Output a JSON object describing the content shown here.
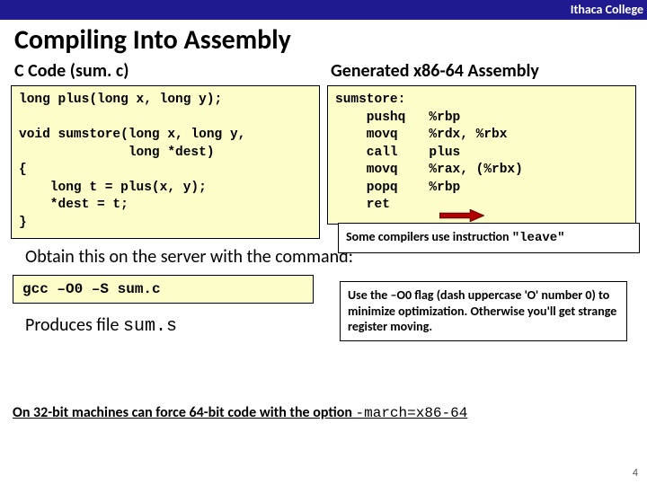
{
  "header": {
    "org": "Ithaca College"
  },
  "title": "Compiling Into Assembly",
  "left": {
    "heading": "C Code (sum. c)",
    "code": "long plus(long x, long y);\n\nvoid sumstore(long x, long y,\n              long *dest)\n{\n    long t = plus(x, y);\n    *dest = t;\n}"
  },
  "right": {
    "heading": "Generated x86-64 Assembly",
    "code": "sumstore:\n    pushq   %rbp\n    movq    %rdx, %rbx\n    call    plus\n    movq    %rax, (%rbx)\n    popq    %rbp\n    ret"
  },
  "notes": {
    "leave_pre": "Some compilers use instruction ",
    "leave_quoted": "\"leave\"",
    "o0": "Use the –O0 flag (dash uppercase 'O' number 0) to minimize optimization. Otherwise you'll get strange register moving."
  },
  "obtain": "Obtain this on the server with the command:",
  "cmd": "gcc –O0 –S sum.c",
  "produces_pre": "Produces file ",
  "produces_file": "sum.s",
  "foot_pre": "On 32-bit machines can force 64-bit code with the option ",
  "foot_opt": "-march=x86-64",
  "page": "4"
}
